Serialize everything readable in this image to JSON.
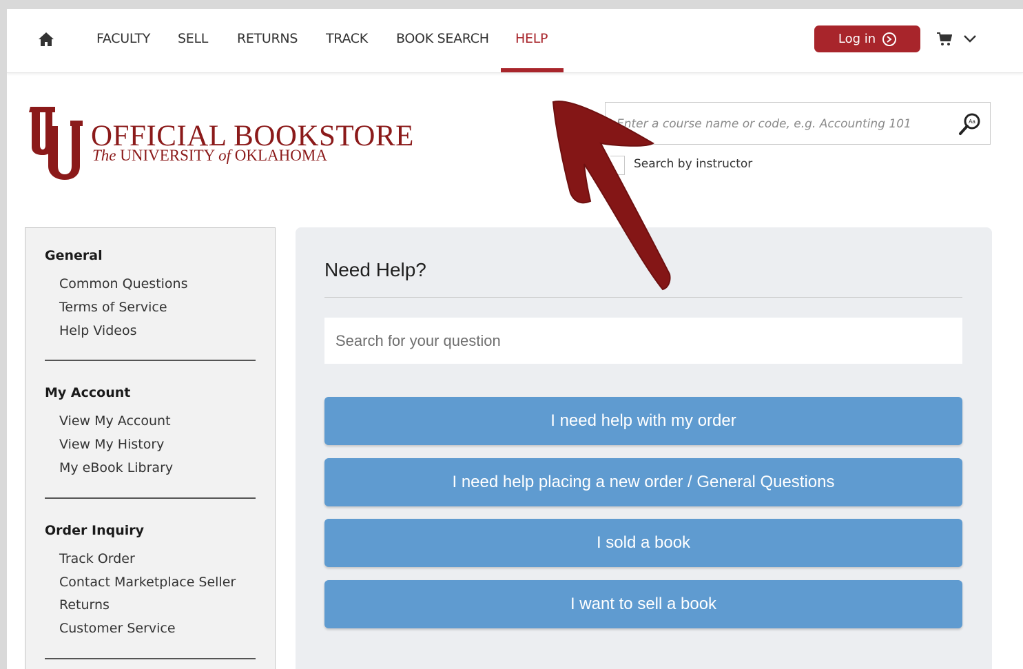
{
  "nav": {
    "home_icon": "home-icon",
    "items": [
      {
        "label": "FACULTY"
      },
      {
        "label": "SELL"
      },
      {
        "label": "RETURNS"
      },
      {
        "label": "TRACK"
      },
      {
        "label": "BOOK SEARCH"
      },
      {
        "label": "HELP",
        "active": true
      }
    ],
    "login_label": "Log in",
    "login_icon": "chevron-right-circle-icon",
    "cart_icon": "cart-icon",
    "dropdown_icon": "chevron-down-icon"
  },
  "brand": {
    "title": "OFFICIAL BOOKSTORE",
    "subtitle_the": "The",
    "subtitle_university": "UNIVERSITY",
    "subtitle_of": "of",
    "subtitle_state": "OKLAHOMA",
    "logo_icon": "ou-logo"
  },
  "course_search": {
    "placeholder": "Enter a course name or code, e.g. Accounting 101",
    "search_icon": "search-icon",
    "instructor_label": "Search by instructor"
  },
  "sidebar": {
    "sections": [
      {
        "heading": "General",
        "links": [
          "Common Questions",
          "Terms of Service",
          "Help Videos"
        ]
      },
      {
        "heading": "My Account",
        "links": [
          "View My Account",
          "View My History",
          "My eBook Library"
        ]
      },
      {
        "heading": "Order Inquiry",
        "links": [
          "Track Order",
          "Contact Marketplace Seller",
          "Returns",
          "Customer Service"
        ]
      }
    ]
  },
  "help": {
    "title": "Need Help?",
    "search_placeholder": "Search for your question",
    "buttons": [
      {
        "label": "I need help with my order"
      },
      {
        "label": "I need help placing a new order / General Questions"
      },
      {
        "label": "I sold a book"
      },
      {
        "label": "I want to sell a book"
      }
    ]
  },
  "colors": {
    "brand": "#a8252b",
    "help_button": "#5f9bd0",
    "arrow": "#841616",
    "panel": "#eceef1"
  },
  "annotation": {
    "icon": "arrow-icon"
  }
}
